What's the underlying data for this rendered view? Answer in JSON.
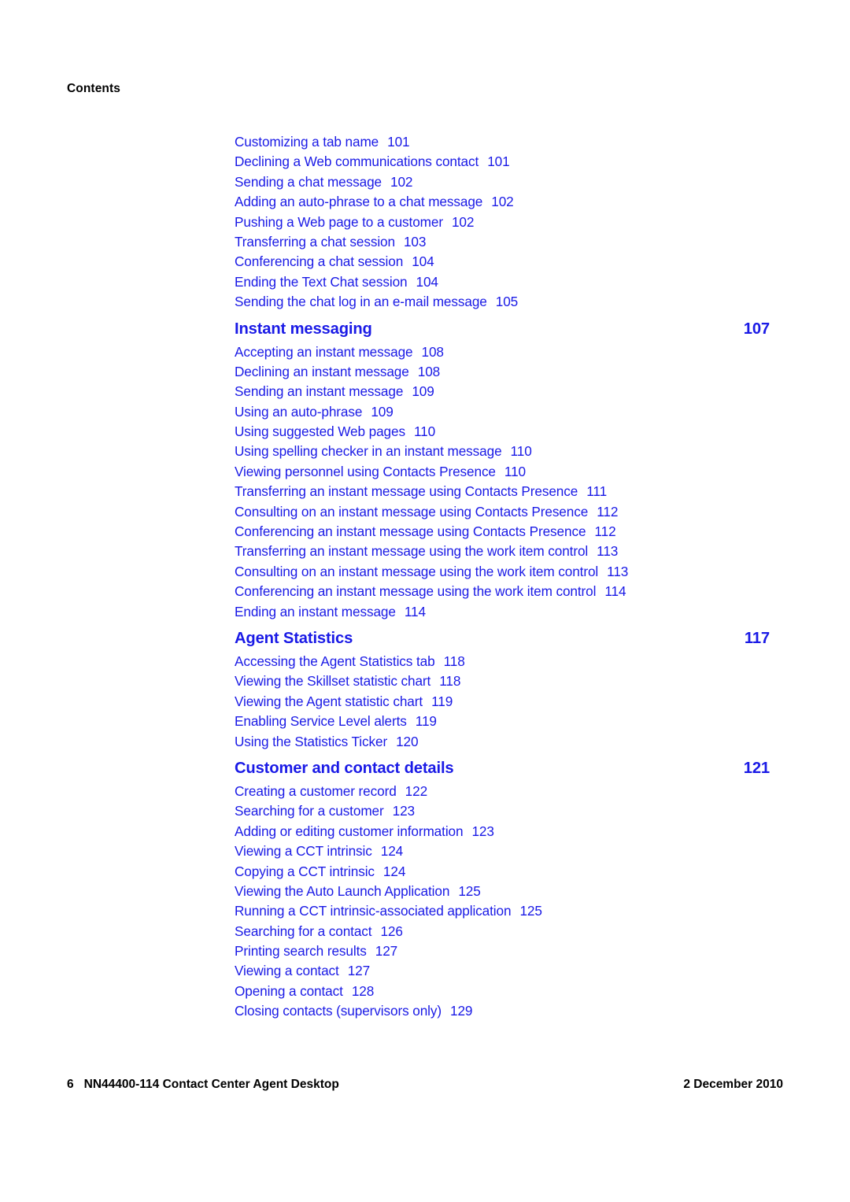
{
  "document": {
    "running_head": "Contents",
    "accent_color": "#1a1ae6",
    "text_color": "#000000",
    "background_color": "#ffffff"
  },
  "toc": {
    "entries": [
      {
        "level": 2,
        "title": "Customizing a tab name",
        "page": "101"
      },
      {
        "level": 2,
        "title": "Declining a Web communications contact",
        "page": "101"
      },
      {
        "level": 2,
        "title": "Sending a chat message",
        "page": "102"
      },
      {
        "level": 2,
        "title": "Adding an auto-phrase to a chat message",
        "page": "102"
      },
      {
        "level": 2,
        "title": "Pushing a Web page to a customer",
        "page": "102"
      },
      {
        "level": 2,
        "title": "Transferring a chat session",
        "page": "103"
      },
      {
        "level": 2,
        "title": "Conferencing a chat session",
        "page": "104"
      },
      {
        "level": 2,
        "title": "Ending the Text Chat session",
        "page": "104"
      },
      {
        "level": 2,
        "title": "Sending the chat log in an e-mail message",
        "page": "105"
      },
      {
        "level": 1,
        "title": "Instant messaging",
        "page": "107"
      },
      {
        "level": 2,
        "title": "Accepting an instant message",
        "page": "108"
      },
      {
        "level": 2,
        "title": "Declining an instant message",
        "page": "108"
      },
      {
        "level": 2,
        "title": "Sending an instant message",
        "page": "109"
      },
      {
        "level": 2,
        "title": "Using an auto-phrase",
        "page": "109"
      },
      {
        "level": 2,
        "title": "Using suggested Web pages",
        "page": "110"
      },
      {
        "level": 2,
        "title": "Using spelling checker in an instant message",
        "page": "110"
      },
      {
        "level": 2,
        "title": "Viewing personnel using Contacts Presence",
        "page": "110"
      },
      {
        "level": 2,
        "title": "Transferring an instant message using Contacts Presence",
        "page": "111"
      },
      {
        "level": 2,
        "title": "Consulting on an instant message using Contacts Presence",
        "page": "112"
      },
      {
        "level": 2,
        "title": "Conferencing an instant message using Contacts Presence",
        "page": "112"
      },
      {
        "level": 2,
        "title": "Transferring an instant message using the work item control",
        "page": "113"
      },
      {
        "level": 2,
        "title": "Consulting on an instant message using the work item control",
        "page": "113"
      },
      {
        "level": 2,
        "title": "Conferencing an instant message using the work item control",
        "page": "114"
      },
      {
        "level": 2,
        "title": "Ending an instant message",
        "page": "114"
      },
      {
        "level": 1,
        "title": "Agent Statistics",
        "page": "117"
      },
      {
        "level": 2,
        "title": "Accessing the Agent Statistics tab",
        "page": "118"
      },
      {
        "level": 2,
        "title": "Viewing the Skillset statistic chart",
        "page": "118"
      },
      {
        "level": 2,
        "title": "Viewing the Agent statistic chart",
        "page": "119"
      },
      {
        "level": 2,
        "title": "Enabling Service Level alerts",
        "page": "119"
      },
      {
        "level": 2,
        "title": "Using the Statistics Ticker",
        "page": "120"
      },
      {
        "level": 1,
        "title": "Customer and contact details",
        "page": "121"
      },
      {
        "level": 2,
        "title": "Creating a customer record",
        "page": "122"
      },
      {
        "level": 2,
        "title": "Searching for a customer",
        "page": "123"
      },
      {
        "level": 2,
        "title": "Adding or editing customer information",
        "page": "123"
      },
      {
        "level": 2,
        "title": "Viewing a CCT intrinsic",
        "page": "124"
      },
      {
        "level": 2,
        "title": "Copying a CCT intrinsic",
        "page": "124"
      },
      {
        "level": 2,
        "title": "Viewing the Auto Launch Application",
        "page": "125"
      },
      {
        "level": 2,
        "title": "Running a CCT intrinsic-associated application",
        "page": "125"
      },
      {
        "level": 2,
        "title": "Searching for a contact",
        "page": "126"
      },
      {
        "level": 2,
        "title": "Printing search results",
        "page": "127"
      },
      {
        "level": 2,
        "title": "Viewing a contact",
        "page": "127"
      },
      {
        "level": 2,
        "title": "Opening a contact",
        "page": "128"
      },
      {
        "level": 2,
        "title": "Closing contacts (supervisors only)",
        "page": "129"
      }
    ]
  },
  "footer": {
    "folio": "6",
    "document_title": "NN44400-114 Contact Center Agent Desktop",
    "date": "2 December 2010"
  }
}
